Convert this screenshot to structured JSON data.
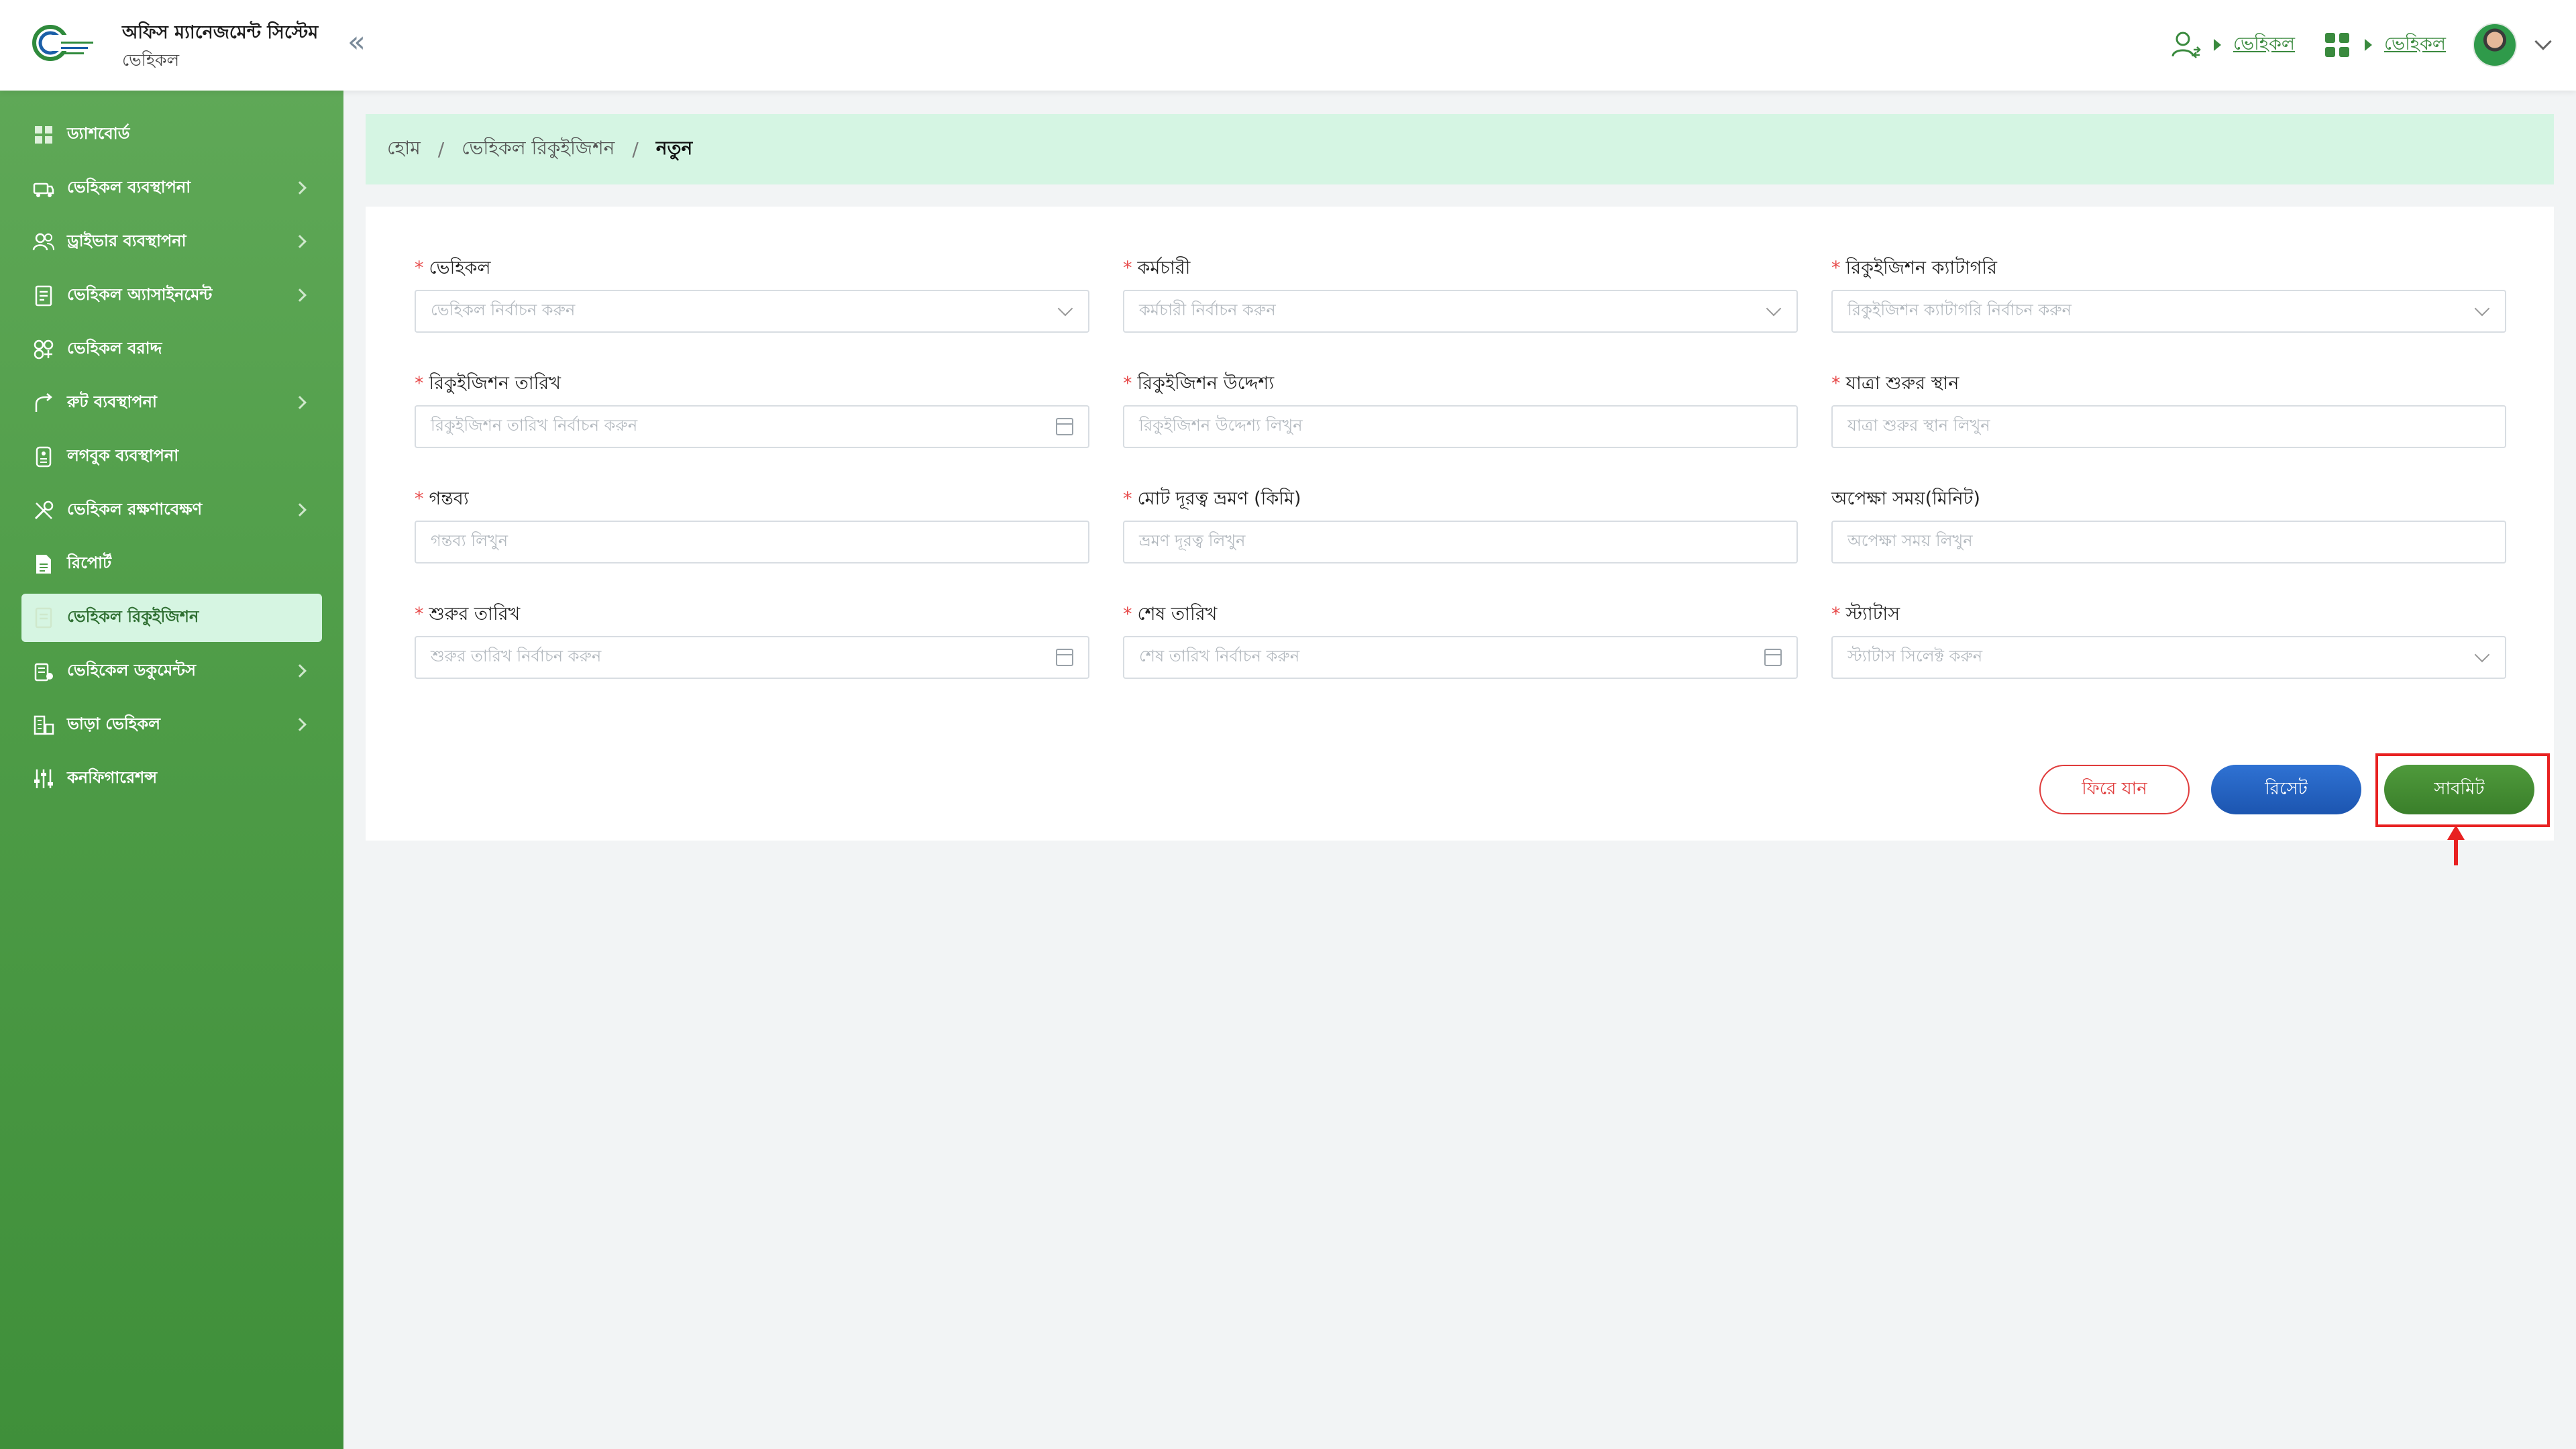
{
  "header": {
    "app_title": "অফিস ম্যানেজমেন্ট সিস্টেম",
    "app_subtitle": "ভেহিকল",
    "collapse_glyph": "«",
    "nav_links": [
      "ভেহিকল",
      "ভেহিকল"
    ],
    "icons": [
      "user-switch-icon",
      "apps-grid-icon",
      "chevron-down-icon"
    ],
    "accent_color": "#3a8a3e"
  },
  "sidebar": {
    "items": [
      {
        "label": "ড্যাশবোর্ড",
        "icon": "dashboard-icon",
        "has_submenu": false
      },
      {
        "label": "ভেহিকল ব্যবস্থাপনা",
        "icon": "vehicle-icon",
        "has_submenu": true
      },
      {
        "label": "ড্রাইভার ব্যবস্থাপনা",
        "icon": "drivers-icon",
        "has_submenu": true
      },
      {
        "label": "ভেহিকল অ্যাসাইনমেন্ট",
        "icon": "assignment-icon",
        "has_submenu": true
      },
      {
        "label": "ভেহিকল বরাদ্দ",
        "icon": "allocation-icon",
        "has_submenu": false
      },
      {
        "label": "রুট ব্যবস্থাপনা",
        "icon": "route-icon",
        "has_submenu": true
      },
      {
        "label": "লগবুক ব্যবস্থাপনা",
        "icon": "logbook-icon",
        "has_submenu": false
      },
      {
        "label": "ভেহিকল রক্ষণাবেক্ষণ",
        "icon": "maintenance-icon",
        "has_submenu": true
      },
      {
        "label": "রিপোর্ট",
        "icon": "report-icon",
        "has_submenu": false
      },
      {
        "label": "ভেহিকল রিকুইজিশন",
        "icon": "requisition-icon",
        "has_submenu": false,
        "active": true
      },
      {
        "label": "ভেহিকেল ডকুমেন্টস",
        "icon": "documents-icon",
        "has_submenu": true
      },
      {
        "label": "ভাড়া ভেহিকল",
        "icon": "rental-icon",
        "has_submenu": true
      },
      {
        "label": "কনফিগারেশন্স",
        "icon": "config-icon",
        "has_submenu": false
      }
    ]
  },
  "breadcrumb": {
    "home": "হোম",
    "parent": "ভেহিকল রিকুইজিশন",
    "current": "নতুন",
    "separator": "/"
  },
  "form": {
    "fields": [
      {
        "label": "ভেহিকল",
        "required": true,
        "type": "select",
        "placeholder": "ভেহিকল নির্বাচন করুন"
      },
      {
        "label": "কর্মচারী",
        "required": true,
        "type": "select",
        "placeholder": "কর্মচারী নির্বাচন করুন"
      },
      {
        "label": "রিকুইজিশন ক্যাটাগরি",
        "required": true,
        "type": "select",
        "placeholder": "রিকুইজিশন ক্যাটাগরি নির্বাচন করুন"
      },
      {
        "label": "রিকুইজিশন তারিখ",
        "required": true,
        "type": "date",
        "placeholder": "রিকুইজিশন তারিখ নির্বাচন করুন"
      },
      {
        "label": "রিকুইজিশন উদ্দেশ্য",
        "required": true,
        "type": "text",
        "placeholder": "রিকুইজিশন উদ্দেশ্য লিখুন"
      },
      {
        "label": "যাত্রা শুরুর স্থান",
        "required": true,
        "type": "text",
        "placeholder": "যাত্রা শুরুর স্থান লিখুন"
      },
      {
        "label": "গন্তব্য",
        "required": true,
        "type": "text",
        "placeholder": "গন্তব্য লিখুন"
      },
      {
        "label": "মোট দূরত্ব ভ্রমণ (কিমি)",
        "required": true,
        "type": "text",
        "placeholder": "ভ্রমণ দূরত্ব লিখুন"
      },
      {
        "label": "অপেক্ষা সময়(মিনিট)",
        "required": false,
        "type": "text",
        "placeholder": "অপেক্ষা সময় লিখুন"
      },
      {
        "label": "শুরুর তারিখ",
        "required": true,
        "type": "date",
        "placeholder": "শুরুর তারিখ নির্বাচন করুন"
      },
      {
        "label": "শেষ তারিখ",
        "required": true,
        "type": "date",
        "placeholder": "শেষ তারিখ নির্বাচন করুন"
      },
      {
        "label": "স্ট্যাটাস",
        "required": true,
        "type": "select",
        "placeholder": "স্ট্যাটাস সিলেক্ট করুন"
      }
    ],
    "buttons": {
      "back": "ফিরে যান",
      "reset": "রিসেট",
      "submit": "সাবমিট"
    },
    "colors": {
      "required_mark": "#e74c4c",
      "back_border": "#e03c3c",
      "reset_bg": "#1f5fbf",
      "submit_bg": "#46903a",
      "highlight": "#e82121"
    }
  }
}
